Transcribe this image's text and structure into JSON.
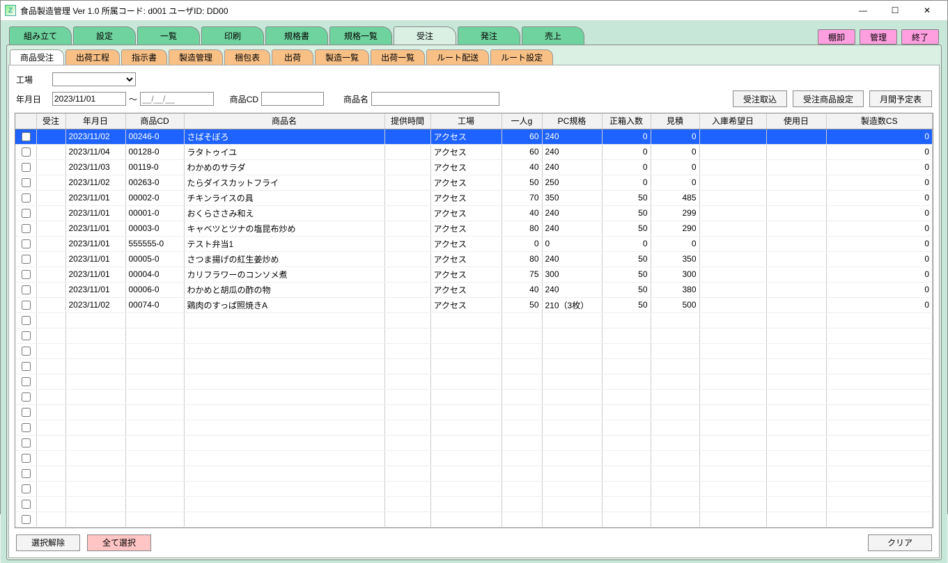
{
  "title": "食品製造管理 Ver 1.0  所属コード: d001        ユーザID: DD00",
  "topTabs": [
    "組み立て",
    "設定",
    "一覧",
    "印刷",
    "規格書",
    "規格一覧",
    "受注",
    "発注",
    "売上"
  ],
  "topActive": 6,
  "topButtons": {
    "tana": "棚卸",
    "kanri": "管理",
    "end": "終了"
  },
  "subTabs": [
    "商品受注",
    "出荷工程",
    "指示書",
    "製造管理",
    "梱包表",
    "出荷",
    "製造一覧",
    "出荷一覧",
    "ルート配送",
    "ルート設定"
  ],
  "subActive": 0,
  "filters": {
    "factoryLabel": "工場",
    "dateLabel": "年月日",
    "dateFrom": "2023/11/01",
    "dateToPlaceholder": "__/__/__",
    "tilde": "～",
    "cdLabel": "商品CD",
    "nameLabel": "商品名",
    "btnImport": "受注取込",
    "btnSetting": "受注商品設定",
    "btnMonthly": "月間予定表"
  },
  "headers": [
    "",
    "受注",
    "年月日",
    "商品CD",
    "商品名",
    "提供時間",
    "工場",
    "一人g",
    "PC規格",
    "正箱入数",
    "見積",
    "入庫希望日",
    "使用日",
    "製造数CS"
  ],
  "rows": [
    {
      "sel": true,
      "date": "2023/11/02",
      "cd": "00246-0",
      "name": "さばそぼろ",
      "fac": "アクセス",
      "g": "60",
      "pc": "240",
      "box": "0",
      "est": "0",
      "cs": "0"
    },
    {
      "date": "2023/11/04",
      "cd": "00128-0",
      "name": "ラタトゥイユ",
      "fac": "アクセス",
      "g": "60",
      "pc": "240",
      "box": "0",
      "est": "0",
      "cs": "0"
    },
    {
      "date": "2023/11/03",
      "cd": "00119-0",
      "name": "わかめのサラダ",
      "fac": "アクセス",
      "g": "40",
      "pc": "240",
      "box": "0",
      "est": "0",
      "cs": "0"
    },
    {
      "date": "2023/11/02",
      "cd": "00263-0",
      "name": "たらダイスカットフライ",
      "fac": "アクセス",
      "g": "50",
      "pc": "250",
      "box": "0",
      "est": "0",
      "cs": "0"
    },
    {
      "date": "2023/11/01",
      "cd": "00002-0",
      "name": "チキンライスの具",
      "fac": "アクセス",
      "g": "70",
      "pc": "350",
      "box": "50",
      "est": "485",
      "cs": "0"
    },
    {
      "date": "2023/11/01",
      "cd": "00001-0",
      "name": "おくらささみ和え",
      "fac": "アクセス",
      "g": "40",
      "pc": "240",
      "box": "50",
      "est": "299",
      "cs": "0"
    },
    {
      "date": "2023/11/01",
      "cd": "00003-0",
      "name": "キャベツとツナの塩昆布炒め",
      "fac": "アクセス",
      "g": "80",
      "pc": "240",
      "box": "50",
      "est": "290",
      "cs": "0"
    },
    {
      "date": "2023/11/01",
      "cd": "555555-0",
      "name": "テスト弁当1",
      "fac": "アクセス",
      "g": "0",
      "pc": "0",
      "box": "0",
      "est": "0",
      "cs": "0"
    },
    {
      "date": "2023/11/01",
      "cd": "00005-0",
      "name": "さつま揚げの紅生姜炒め",
      "fac": "アクセス",
      "g": "80",
      "pc": "240",
      "box": "50",
      "est": "350",
      "cs": "0"
    },
    {
      "date": "2023/11/01",
      "cd": "00004-0",
      "name": "カリフラワーのコンソメ煮",
      "fac": "アクセス",
      "g": "75",
      "pc": "300",
      "box": "50",
      "est": "300",
      "cs": "0"
    },
    {
      "date": "2023/11/01",
      "cd": "00006-0",
      "name": "わかめと胡瓜の酢の物",
      "fac": "アクセス",
      "g": "40",
      "pc": "240",
      "box": "50",
      "est": "380",
      "cs": "0"
    },
    {
      "date": "2023/11/02",
      "cd": "00074-0",
      "name": "鶏肉のすっぱ照焼きA",
      "fac": "アクセス",
      "g": "50",
      "pc": "210（3枚）",
      "box": "50",
      "est": "500",
      "cs": "0"
    }
  ],
  "emptyRows": 14,
  "footer": {
    "deselect": "選択解除",
    "selectAll": "全て選択",
    "clear": "クリア"
  }
}
